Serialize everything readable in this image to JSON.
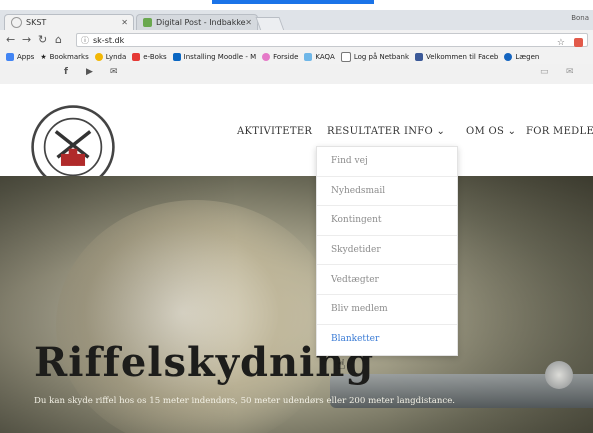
{
  "browser": {
    "tabs": [
      {
        "title": "SKST",
        "active": true
      },
      {
        "title": "Digital Post - Indbakke",
        "active": false
      }
    ],
    "user_label": "Bona",
    "address": "sk-st.dk",
    "bookmarks": [
      "Apps",
      "Bookmarks",
      "Lynda",
      "e-Boks",
      "Installing Moodle - M",
      "Forside",
      "KAQA",
      "Log på Netbank",
      "Velkommen til Faceb",
      "Lægen"
    ]
  },
  "social": {
    "facebook": "f",
    "youtube": "▶",
    "mail": "✉"
  },
  "site": {
    "logo_text": "SKANDERBORG-STILLING SKYTTEFORENING",
    "nav": [
      "AKTIVITETER",
      "RESULTATER",
      "INFO ⌄",
      "OM OS ⌄",
      "FOR MEDLEM"
    ],
    "dropdown": [
      "Find vej",
      "Nyhedsmail",
      "Kontingent",
      "Skydetider",
      "Vedtægter",
      "Bliv medlem",
      "Blanketter"
    ],
    "hero_title": "Riffelskydning",
    "hero_text": "Du kan skyde riffel hos os 15 meter indendørs, 50 meter udendørs eller 200 meter langdistance."
  },
  "colors": {
    "accent": "#1a73e8",
    "link_hover": "#3a7bd5"
  }
}
